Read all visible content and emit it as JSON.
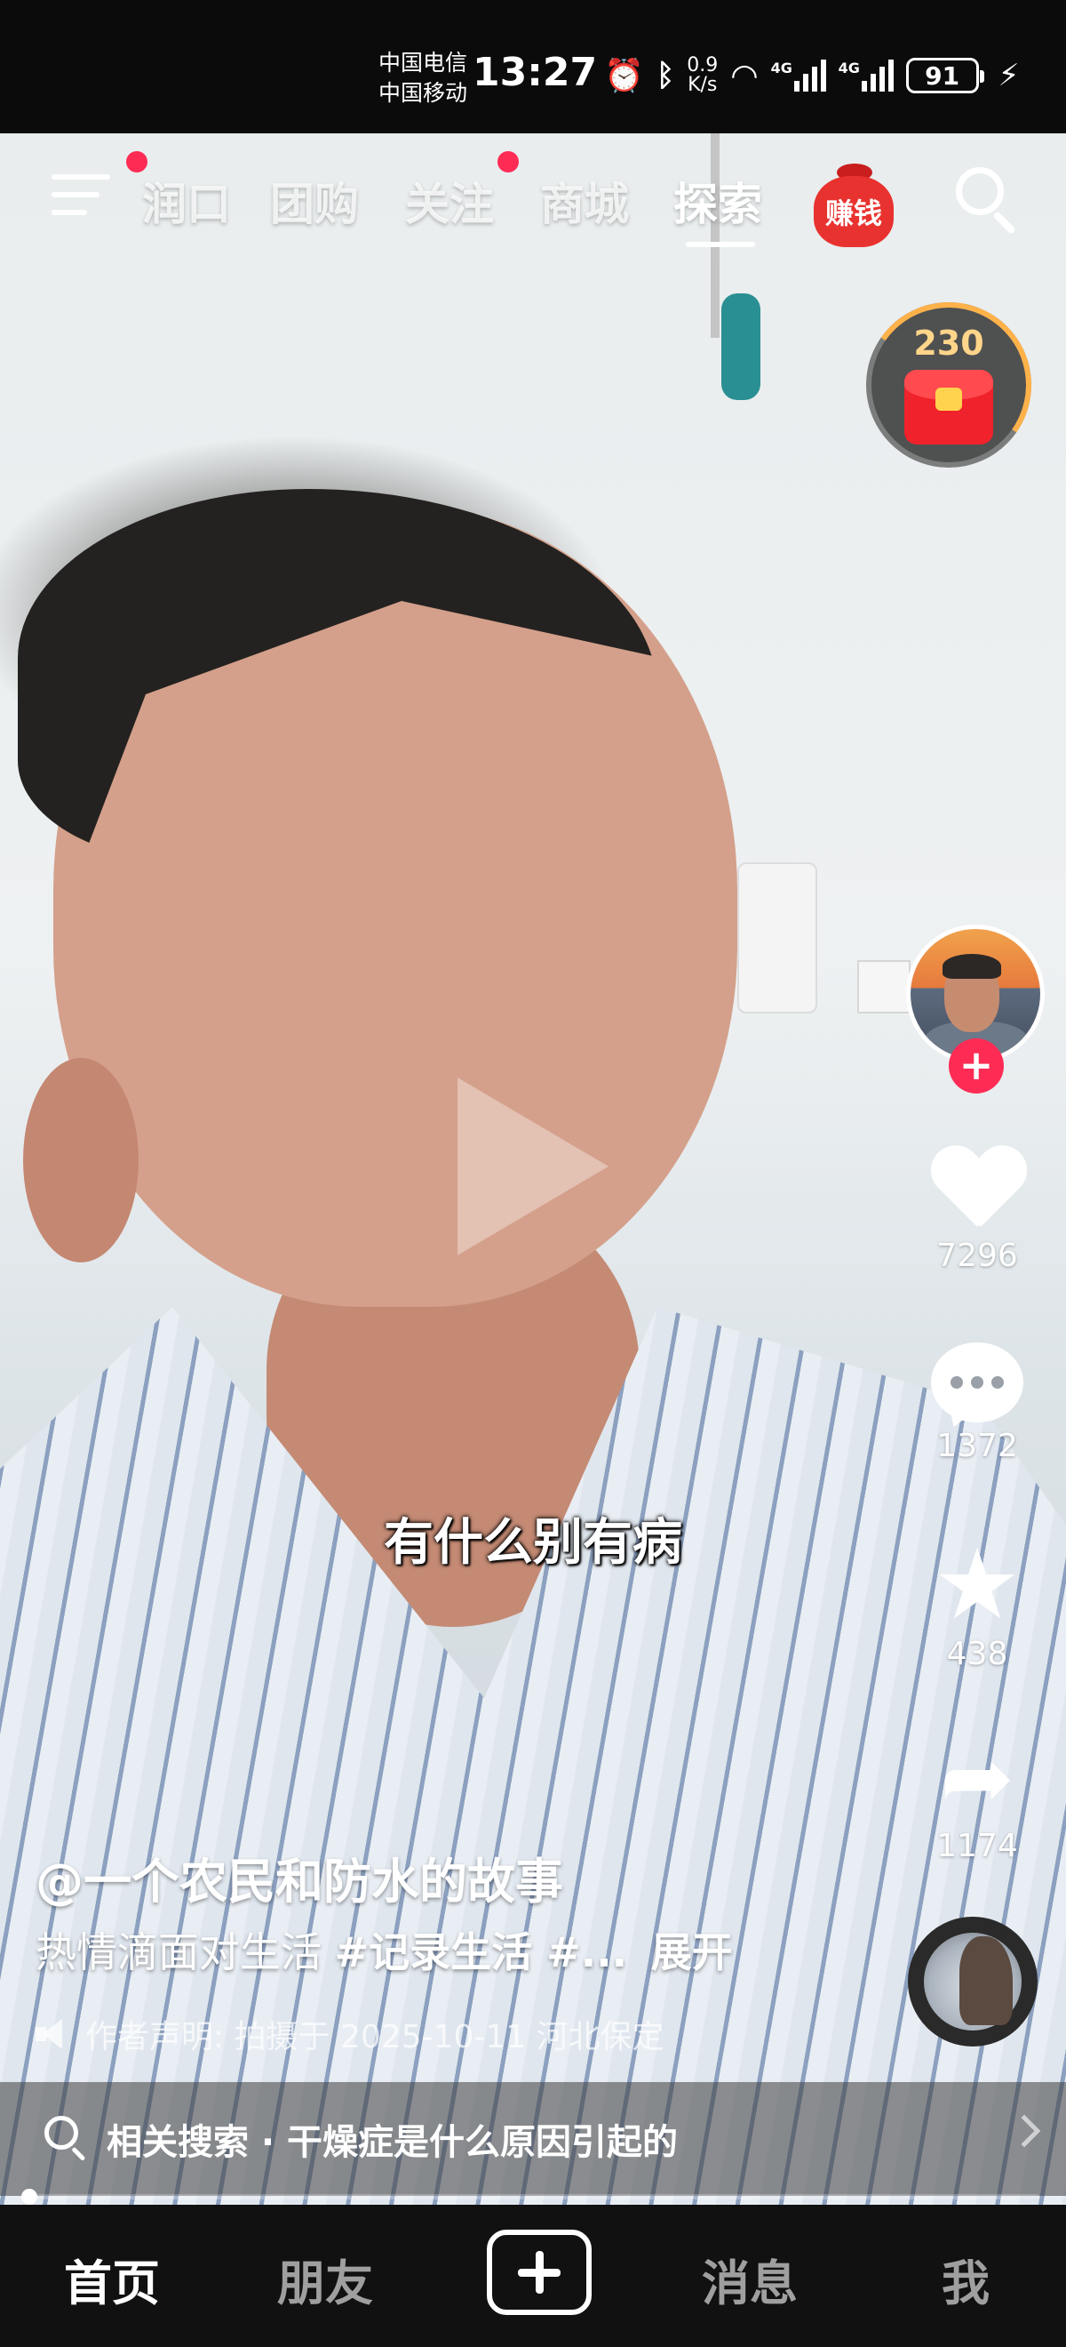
{
  "status_bar": {
    "carrier_1": "中国电信",
    "carrier_2": "中国移动",
    "time": "13:27",
    "net_speed_value": "0.9",
    "net_speed_unit": "K/s",
    "signal_1_label": "4G",
    "signal_2_label": "4G",
    "battery": "91"
  },
  "top_nav": {
    "tabs": [
      {
        "label": "润口",
        "active": false,
        "badge": false
      },
      {
        "label": "团购",
        "active": false,
        "badge": false
      },
      {
        "label": "关注",
        "active": false,
        "badge": true
      },
      {
        "label": "商城",
        "active": false,
        "badge": false
      },
      {
        "label": "探索",
        "active": true,
        "badge": false
      }
    ],
    "earn_label": "赚钱",
    "menu_has_badge": true
  },
  "red_packet": {
    "count": "230"
  },
  "video": {
    "subtitle": "有什么别有病"
  },
  "right_rail": {
    "likes": "7296",
    "comments": "1372",
    "favorites": "438",
    "shares": "1174"
  },
  "post": {
    "author": "@一个农民和防水的故事",
    "description": "热情滴面对生活",
    "tags": "#记录生活 #...",
    "expand_label": "展开",
    "declaration": "作者声明:  拍摄于 2025-10-11 河北保定"
  },
  "related_search": {
    "text": "相关搜索 · 干燥症是什么原因引起的"
  },
  "playback": {
    "progress": 0.01
  },
  "bottom_tabs": {
    "home": "首页",
    "friends": "朋友",
    "messages": "消息",
    "me": "我"
  },
  "colors": {
    "accent": "#fe2c55",
    "earn_red": "#e8322f",
    "packet_gold": "#ffd58a"
  }
}
